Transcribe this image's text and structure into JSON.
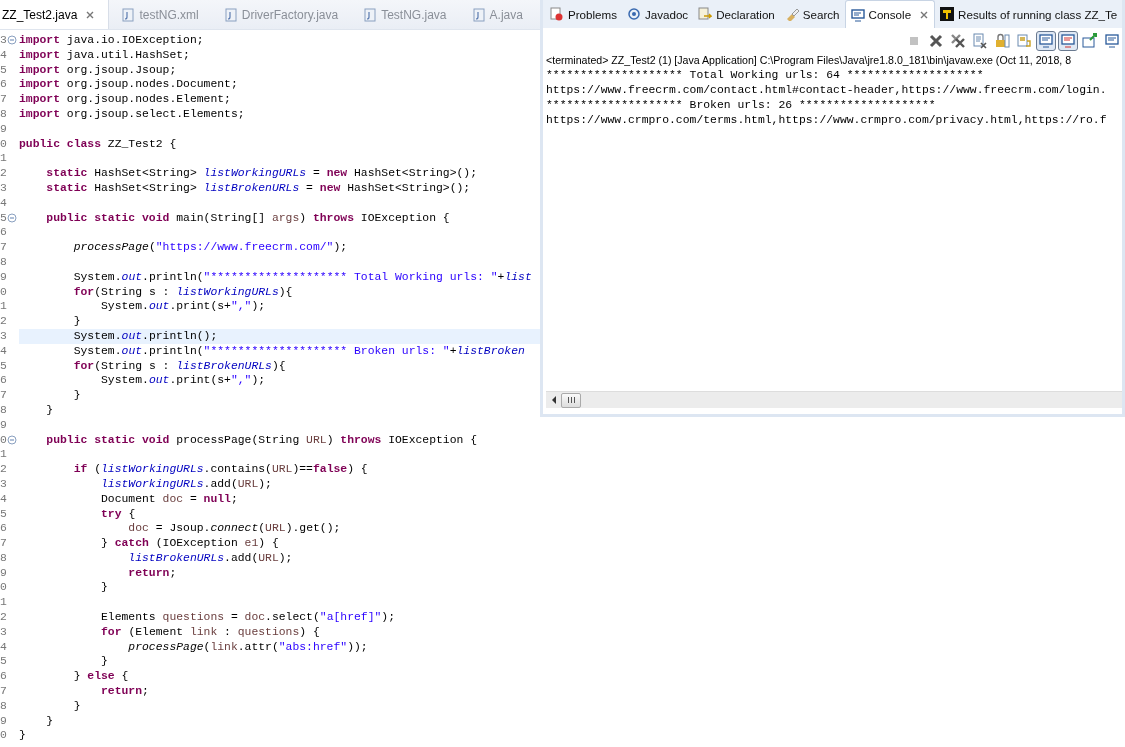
{
  "editor": {
    "tabs": [
      {
        "label": "ZZ_Test2.java",
        "selected": true
      },
      {
        "label": "testNG.xml",
        "selected": false
      },
      {
        "label": "DriverFactory.java",
        "selected": false
      },
      {
        "label": "TestNG.java",
        "selected": false
      },
      {
        "label": "A.java",
        "selected": false
      }
    ],
    "lines": [
      {
        "number": "3",
        "fold": true,
        "current": false,
        "tokens": [
          {
            "kind": "kw",
            "text": "import"
          },
          {
            "kind": "plain",
            "text": " java.io.IOException;"
          }
        ]
      },
      {
        "number": "4",
        "fold": false,
        "current": false,
        "tokens": [
          {
            "kind": "kw",
            "text": "import"
          },
          {
            "kind": "plain",
            "text": " java.util.HashSet;"
          }
        ]
      },
      {
        "number": "5",
        "fold": false,
        "current": false,
        "tokens": [
          {
            "kind": "kw",
            "text": "import"
          },
          {
            "kind": "plain",
            "text": " org.jsoup.Jsoup;"
          }
        ]
      },
      {
        "number": "6",
        "fold": false,
        "current": false,
        "tokens": [
          {
            "kind": "kw",
            "text": "import"
          },
          {
            "kind": "plain",
            "text": " org.jsoup.nodes.Document;"
          }
        ]
      },
      {
        "number": "7",
        "fold": false,
        "current": false,
        "tokens": [
          {
            "kind": "kw",
            "text": "import"
          },
          {
            "kind": "plain",
            "text": " org.jsoup.nodes.Element;"
          }
        ]
      },
      {
        "number": "8",
        "fold": false,
        "current": false,
        "tokens": [
          {
            "kind": "kw",
            "text": "import"
          },
          {
            "kind": "plain",
            "text": " org.jsoup.select.Elements;"
          }
        ]
      },
      {
        "number": "9",
        "fold": false,
        "current": false
      },
      {
        "number": "0",
        "fold": false,
        "current": false,
        "tokens": [
          {
            "kind": "kw",
            "text": "public class"
          },
          {
            "kind": "plain",
            "text": " ZZ_Test2 {"
          }
        ]
      },
      {
        "number": "1",
        "fold": false,
        "current": false
      },
      {
        "number": "2",
        "fold": false,
        "current": false,
        "tokens": [
          {
            "kind": "kw",
            "text": "    static"
          },
          {
            "kind": "plain",
            "text": " HashSet<String> "
          },
          {
            "kind": "field",
            "text": "listWorkingURLs"
          },
          {
            "kind": "plain",
            "text": " = "
          },
          {
            "kind": "kw",
            "text": "new"
          },
          {
            "kind": "plain",
            "text": " HashSet<String>();"
          }
        ]
      },
      {
        "number": "3",
        "fold": false,
        "current": false,
        "tokens": [
          {
            "kind": "kw",
            "text": "    static"
          },
          {
            "kind": "plain",
            "text": " HashSet<String> "
          },
          {
            "kind": "field",
            "text": "listBrokenURLs"
          },
          {
            "kind": "plain",
            "text": " = "
          },
          {
            "kind": "kw",
            "text": "new"
          },
          {
            "kind": "plain",
            "text": " HashSet<String>();"
          }
        ]
      },
      {
        "number": "4",
        "fold": false,
        "current": false
      },
      {
        "number": "5",
        "fold": true,
        "current": false,
        "tokens": [
          {
            "kind": "kw",
            "text": "    public static void"
          },
          {
            "kind": "plain",
            "text": " main(String[] "
          },
          {
            "kind": "local",
            "text": "args"
          },
          {
            "kind": "plain",
            "text": ") "
          },
          {
            "kind": "kw",
            "text": "throws"
          },
          {
            "kind": "plain",
            "text": " IOException {"
          }
        ]
      },
      {
        "number": "6",
        "fold": false,
        "current": false
      },
      {
        "number": "7",
        "fold": false,
        "current": false,
        "tokens": [
          {
            "kind": "method",
            "text": "        processPage"
          },
          {
            "kind": "plain",
            "text": "("
          },
          {
            "kind": "str",
            "text": "\"https://www.freecrm.com/\""
          },
          {
            "kind": "plain",
            "text": ");"
          }
        ]
      },
      {
        "number": "8",
        "fold": false,
        "current": false
      },
      {
        "number": "9",
        "fold": false,
        "current": false,
        "tokens": [
          {
            "kind": "plain",
            "text": "        System."
          },
          {
            "kind": "field",
            "text": "out"
          },
          {
            "kind": "plain",
            "text": ".println("
          },
          {
            "kind": "str",
            "text": "\"******************** Total Working urls: \""
          },
          {
            "kind": "plain",
            "text": "+"
          },
          {
            "kind": "field",
            "text": "list"
          }
        ]
      },
      {
        "number": "0",
        "fold": false,
        "current": false,
        "tokens": [
          {
            "kind": "kw",
            "text": "        for"
          },
          {
            "kind": "plain",
            "text": "(String s : "
          },
          {
            "kind": "field",
            "text": "listWorkingURLs"
          },
          {
            "kind": "plain",
            "text": "){"
          }
        ]
      },
      {
        "number": "1",
        "fold": false,
        "current": false,
        "tokens": [
          {
            "kind": "plain",
            "text": "            System."
          },
          {
            "kind": "field",
            "text": "out"
          },
          {
            "kind": "plain",
            "text": ".print(s+"
          },
          {
            "kind": "str",
            "text": "\",\""
          },
          {
            "kind": "plain",
            "text": ");"
          }
        ]
      },
      {
        "number": "2",
        "fold": false,
        "current": false,
        "tokens": [
          {
            "kind": "plain",
            "text": "        }"
          }
        ]
      },
      {
        "number": "3",
        "fold": false,
        "current": true,
        "tokens": [
          {
            "kind": "plain",
            "text": "        System."
          },
          {
            "kind": "field",
            "text": "out"
          },
          {
            "kind": "plain",
            "text": ".println();"
          }
        ]
      },
      {
        "number": "4",
        "fold": false,
        "current": false,
        "tokens": [
          {
            "kind": "plain",
            "text": "        System."
          },
          {
            "kind": "field",
            "text": "out"
          },
          {
            "kind": "plain",
            "text": ".println("
          },
          {
            "kind": "str",
            "text": "\"******************** Broken urls: \""
          },
          {
            "kind": "plain",
            "text": "+"
          },
          {
            "kind": "field",
            "text": "listBroken"
          }
        ]
      },
      {
        "number": "5",
        "fold": false,
        "current": false,
        "tokens": [
          {
            "kind": "kw",
            "text": "        for"
          },
          {
            "kind": "plain",
            "text": "(String s : "
          },
          {
            "kind": "field",
            "text": "listBrokenURLs"
          },
          {
            "kind": "plain",
            "text": "){"
          }
        ]
      },
      {
        "number": "6",
        "fold": false,
        "current": false,
        "tokens": [
          {
            "kind": "plain",
            "text": "            System."
          },
          {
            "kind": "field",
            "text": "out"
          },
          {
            "kind": "plain",
            "text": ".print(s+"
          },
          {
            "kind": "str",
            "text": "\",\""
          },
          {
            "kind": "plain",
            "text": ");"
          }
        ]
      },
      {
        "number": "7",
        "fold": false,
        "current": false,
        "tokens": [
          {
            "kind": "plain",
            "text": "        }"
          }
        ]
      },
      {
        "number": "8",
        "fold": false,
        "current": false,
        "tokens": [
          {
            "kind": "plain",
            "text": "    }"
          }
        ]
      },
      {
        "number": "9",
        "fold": false,
        "current": false
      },
      {
        "number": "0",
        "fold": true,
        "current": false,
        "tokens": [
          {
            "kind": "kw",
            "text": "    public static void"
          },
          {
            "kind": "plain",
            "text": " processPage(String "
          },
          {
            "kind": "local",
            "text": "URL"
          },
          {
            "kind": "plain",
            "text": ") "
          },
          {
            "kind": "kw",
            "text": "throws"
          },
          {
            "kind": "plain",
            "text": " IOException {"
          }
        ]
      },
      {
        "number": "1",
        "fold": false,
        "current": false
      },
      {
        "number": "2",
        "fold": false,
        "current": false,
        "tokens": [
          {
            "kind": "kw",
            "text": "        if"
          },
          {
            "kind": "plain",
            "text": " ("
          },
          {
            "kind": "field",
            "text": "listWorkingURLs"
          },
          {
            "kind": "plain",
            "text": ".contains("
          },
          {
            "kind": "local",
            "text": "URL"
          },
          {
            "kind": "plain",
            "text": ")=="
          },
          {
            "kind": "kw",
            "text": "false"
          },
          {
            "kind": "plain",
            "text": ") {"
          }
        ]
      },
      {
        "number": "3",
        "fold": false,
        "current": false,
        "tokens": [
          {
            "kind": "field",
            "text": "            listWorkingURLs"
          },
          {
            "kind": "plain",
            "text": ".add("
          },
          {
            "kind": "local",
            "text": "URL"
          },
          {
            "kind": "plain",
            "text": ");"
          }
        ]
      },
      {
        "number": "4",
        "fold": false,
        "current": false,
        "tokens": [
          {
            "kind": "plain",
            "text": "            Document "
          },
          {
            "kind": "local",
            "text": "doc"
          },
          {
            "kind": "plain",
            "text": " = "
          },
          {
            "kind": "kw",
            "text": "null"
          },
          {
            "kind": "plain",
            "text": ";"
          }
        ]
      },
      {
        "number": "5",
        "fold": false,
        "current": false,
        "tokens": [
          {
            "kind": "kw",
            "text": "            try"
          },
          {
            "kind": "plain",
            "text": " {"
          }
        ]
      },
      {
        "number": "6",
        "fold": false,
        "current": false,
        "tokens": [
          {
            "kind": "local",
            "text": "                doc"
          },
          {
            "kind": "plain",
            "text": " = Jsoup."
          },
          {
            "kind": "method",
            "text": "connect"
          },
          {
            "kind": "plain",
            "text": "("
          },
          {
            "kind": "local",
            "text": "URL"
          },
          {
            "kind": "plain",
            "text": ").get();"
          }
        ]
      },
      {
        "number": "7",
        "fold": false,
        "current": false,
        "tokens": [
          {
            "kind": "plain",
            "text": "            } "
          },
          {
            "kind": "kw",
            "text": "catch"
          },
          {
            "kind": "plain",
            "text": " (IOException "
          },
          {
            "kind": "local",
            "text": "e1"
          },
          {
            "kind": "plain",
            "text": ") {"
          }
        ]
      },
      {
        "number": "8",
        "fold": false,
        "current": false,
        "tokens": [
          {
            "kind": "field",
            "text": "                listBrokenURLs"
          },
          {
            "kind": "plain",
            "text": ".add("
          },
          {
            "kind": "local",
            "text": "URL"
          },
          {
            "kind": "plain",
            "text": ");"
          }
        ]
      },
      {
        "number": "9",
        "fold": false,
        "current": false,
        "tokens": [
          {
            "kind": "kw",
            "text": "                return"
          },
          {
            "kind": "plain",
            "text": ";"
          }
        ]
      },
      {
        "number": "0",
        "fold": false,
        "current": false,
        "tokens": [
          {
            "kind": "plain",
            "text": "            }"
          }
        ]
      },
      {
        "number": "1",
        "fold": false,
        "current": false
      },
      {
        "number": "2",
        "fold": false,
        "current": false,
        "tokens": [
          {
            "kind": "plain",
            "text": "            Elements "
          },
          {
            "kind": "local",
            "text": "questions"
          },
          {
            "kind": "plain",
            "text": " = "
          },
          {
            "kind": "local",
            "text": "doc"
          },
          {
            "kind": "plain",
            "text": ".select("
          },
          {
            "kind": "str",
            "text": "\"a[href]\""
          },
          {
            "kind": "plain",
            "text": ");"
          }
        ]
      },
      {
        "number": "3",
        "fold": false,
        "current": false,
        "tokens": [
          {
            "kind": "kw",
            "text": "            for"
          },
          {
            "kind": "plain",
            "text": " (Element "
          },
          {
            "kind": "local",
            "text": "link"
          },
          {
            "kind": "plain",
            "text": " : "
          },
          {
            "kind": "local",
            "text": "questions"
          },
          {
            "kind": "plain",
            "text": ") {"
          }
        ]
      },
      {
        "number": "4",
        "fold": false,
        "current": false,
        "tokens": [
          {
            "kind": "method",
            "text": "                processPage"
          },
          {
            "kind": "plain",
            "text": "("
          },
          {
            "kind": "local",
            "text": "link"
          },
          {
            "kind": "plain",
            "text": ".attr("
          },
          {
            "kind": "str",
            "text": "\"abs:href\""
          },
          {
            "kind": "plain",
            "text": "));"
          }
        ]
      },
      {
        "number": "5",
        "fold": false,
        "current": false,
        "tokens": [
          {
            "kind": "plain",
            "text": "            }"
          }
        ]
      },
      {
        "number": "6",
        "fold": false,
        "current": false,
        "tokens": [
          {
            "kind": "plain",
            "text": "        } "
          },
          {
            "kind": "kw",
            "text": "else"
          },
          {
            "kind": "plain",
            "text": " {"
          }
        ]
      },
      {
        "number": "7",
        "fold": false,
        "current": false,
        "tokens": [
          {
            "kind": "kw",
            "text": "            return"
          },
          {
            "kind": "plain",
            "text": ";"
          }
        ]
      },
      {
        "number": "8",
        "fold": false,
        "current": false,
        "tokens": [
          {
            "kind": "plain",
            "text": "        }"
          }
        ]
      },
      {
        "number": "9",
        "fold": false,
        "current": false,
        "tokens": [
          {
            "kind": "plain",
            "text": "    }"
          }
        ]
      },
      {
        "number": "0",
        "fold": false,
        "current": false,
        "tokens": [
          {
            "kind": "plain",
            "text": "}"
          }
        ]
      }
    ]
  },
  "console": {
    "tabs": [
      {
        "label": "Problems",
        "selected": false
      },
      {
        "label": "Javadoc",
        "selected": false
      },
      {
        "label": "Declaration",
        "selected": false
      },
      {
        "label": "Search",
        "selected": false
      },
      {
        "label": "Console",
        "selected": true
      },
      {
        "label": "Results of running class ZZ_Te",
        "selected": false
      }
    ],
    "toolbar": [
      {
        "disabled": true,
        "on": false
      },
      {
        "disabled": false,
        "on": false
      },
      {
        "disabled": false,
        "on": false
      },
      {
        "disabled": false,
        "on": false
      },
      {
        "disabled": false,
        "on": false
      },
      {
        "disabled": false,
        "on": false
      },
      {
        "disabled": false,
        "on": true
      },
      {
        "disabled": false,
        "on": true
      },
      {
        "disabled": false,
        "on": false
      },
      {
        "disabled": false,
        "on": false
      }
    ],
    "header": "<terminated> ZZ_Test2 (1) [Java Application] C:\\Program Files\\Java\\jre1.8.0_181\\bin\\javaw.exe (Oct 11, 2018, 8",
    "output": [
      "******************** Total Working urls: 64 ********************",
      "https://www.freecrm.com/contact.html#contact-header,https://www.freecrm.com/login.",
      "******************** Broken urls: 26 ********************",
      "https://www.crmpro.com/terms.html,https://www.crmpro.com/privacy.html,https://ro.f"
    ]
  }
}
